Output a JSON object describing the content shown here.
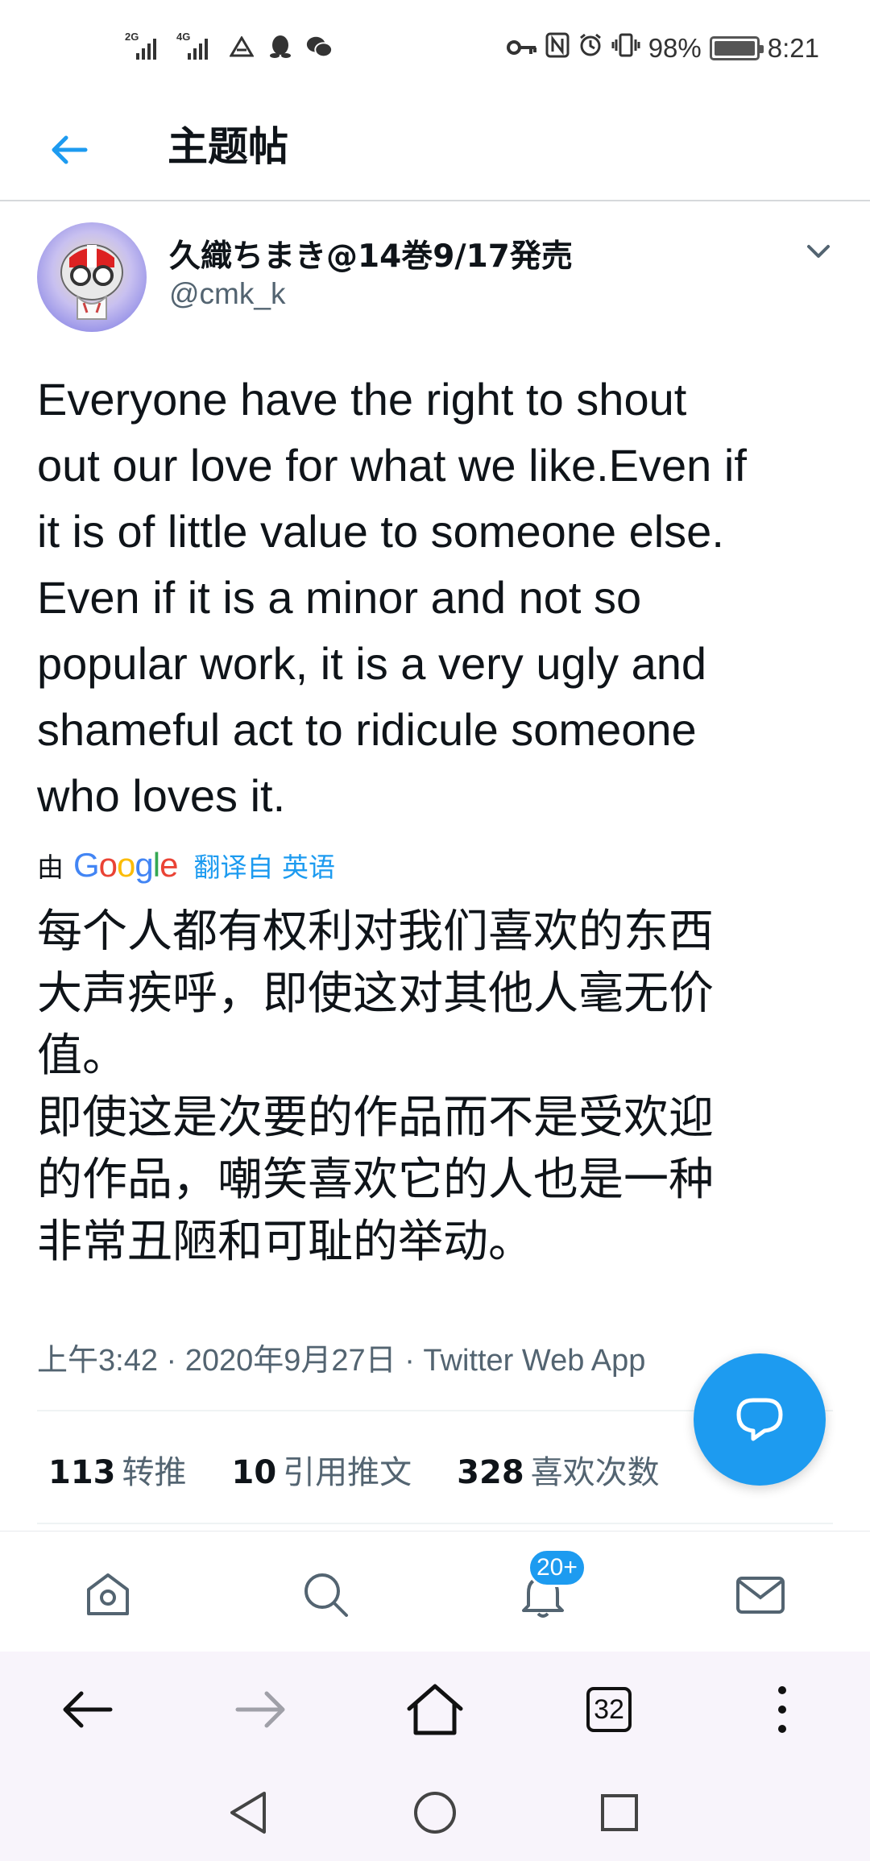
{
  "status_bar": {
    "signal1_label": "2G",
    "signal2_label": "4G",
    "battery": "98%",
    "time": "8:21"
  },
  "header": {
    "title": "主题帖"
  },
  "tweet": {
    "author_name": "久織ちまき@14巻9/17発売",
    "author_handle": "@cmk_k",
    "text": "Everyone have the right to shout\nout our love for what we like.Even if\nit is of little value to someone else.\nEven if it is a minor and not so\npopular work, it is a very ugly and\nshameful act to ridicule someone\nwho loves it.",
    "translation_by": "由",
    "translation_provider": "Google",
    "translation_link": "翻译自 英语",
    "translated_text": "每个人都有权利对我们喜欢的东西\n大声疾呼，即使这对其他人毫无价\n值。\n即使这是次要的作品而不是受欢迎\n的作品，嘲笑喜欢它的人也是一种\n非常丑陋和可耻的举动。",
    "timestamp": "上午3:42 · 2020年9月27日 · Twitter Web App",
    "stats": {
      "retweets": "113",
      "retweets_label": "转推",
      "quotes": "10",
      "quotes_label": "引用推文",
      "likes": "328",
      "likes_label": "喜欢次数"
    }
  },
  "tabbar": {
    "notification_badge": "20+",
    "icons": [
      "home-icon",
      "search-icon",
      "notifications-icon",
      "messages-icon"
    ]
  },
  "browser": {
    "tab_count": "32"
  },
  "colors": {
    "accent": "#1d9bf0",
    "text": "#0f1419",
    "secondary": "#536471"
  }
}
